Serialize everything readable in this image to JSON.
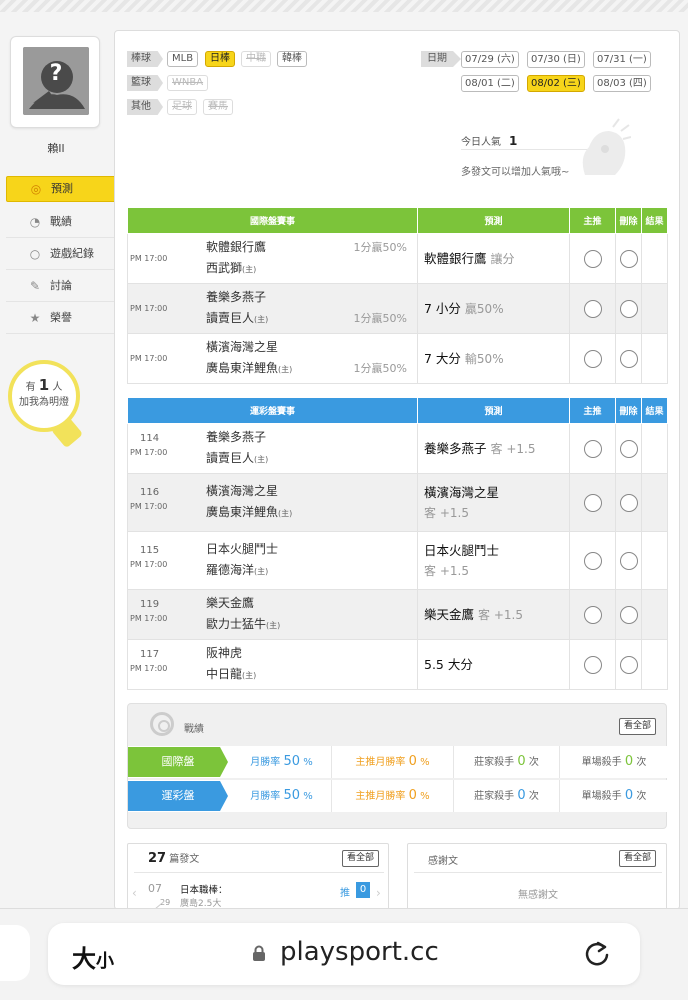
{
  "sidebar": {
    "avatar_glyph": "?",
    "username": "賴ll",
    "menu": [
      {
        "label": "預測",
        "icon": "target-icon"
      },
      {
        "label": "戰績",
        "icon": "chart-icon"
      },
      {
        "label": "遊戲紀錄",
        "icon": "record-icon"
      },
      {
        "label": "討論",
        "icon": "chat-icon"
      },
      {
        "label": "榮譽",
        "icon": "medal-icon"
      }
    ],
    "bulb_prefix": "有",
    "bulb_count": "1",
    "bulb_suffix": "人",
    "bulb_text": "加我為明燈"
  },
  "filters": {
    "baseball_label": "棒球",
    "baseball": [
      "MLB",
      "日棒",
      "中職",
      "韓棒"
    ],
    "basketball_label": "籃球",
    "basketball": [
      "WNBA"
    ],
    "other_label": "其他",
    "other": [
      "足球",
      "賽馬"
    ]
  },
  "dates": {
    "label": "日期",
    "items": [
      "07/29 (六)",
      "07/30 (日)",
      "07/31 (一)",
      "08/01 (二)",
      "08/02 (三)",
      "08/03 (四)"
    ],
    "selected": "08/02 (三)"
  },
  "popularity": {
    "label": "今日人氣",
    "value": "1",
    "desc": "多發文可以增加人氣哦~"
  },
  "intl_table": {
    "headers": [
      "國際盤賽事",
      "預測",
      "主推",
      "刪除",
      "結果"
    ],
    "rows": [
      {
        "time": "PM 17:00",
        "team1": "軟體銀行鷹",
        "team2": "西武獅",
        "home_mark": "(主)",
        "handicap": "1分贏50%",
        "pred_main": "軟體銀行鷹",
        "pred_sub": "讓分"
      },
      {
        "time": "PM 17:00",
        "team1": "養樂多燕子",
        "team2": "讀賣巨人",
        "home_mark": "(主)",
        "handicap": "1分贏50%",
        "pred_main": "7 小分",
        "pred_sub": "贏50%"
      },
      {
        "time": "PM 17:00",
        "team1": "橫濱海灣之星",
        "team2": "廣島東洋鯉魚",
        "home_mark": "(主)",
        "handicap": "1分贏50%",
        "pred_main": "7 大分",
        "pred_sub": "輸50%"
      }
    ]
  },
  "lottery_table": {
    "headers": [
      "運彩盤賽事",
      "預測",
      "主推",
      "刪除",
      "結果"
    ],
    "rows": [
      {
        "no": "114",
        "time": "PM 17:00",
        "team1": "養樂多燕子",
        "team2": "讀賣巨人",
        "home_mark": "(主)",
        "pred_main": "養樂多燕子",
        "pred_sub": "客 +1.5"
      },
      {
        "no": "116",
        "time": "PM 17:00",
        "team1": "橫濱海灣之星",
        "team2": "廣島東洋鯉魚",
        "home_mark": "(主)",
        "pred_main": "橫濱海灣之星",
        "pred_sub": "客 +1.5"
      },
      {
        "no": "115",
        "time": "PM 17:00",
        "team1": "日本火腿鬥士",
        "team2": "羅德海洋",
        "home_mark": "(主)",
        "pred_main": "日本火腿鬥士",
        "pred_sub": "客 +1.5"
      },
      {
        "no": "119",
        "time": "PM 17:00",
        "team1": "樂天金鷹",
        "team2": "歐力士猛牛",
        "home_mark": "(主)",
        "pred_main": "樂天金鷹",
        "pred_sub": "客 +1.5"
      },
      {
        "no": "117",
        "time": "PM 17:00",
        "team1": "阪神虎",
        "team2": "中日龍",
        "home_mark": "(主)",
        "pred_main": "5.5 大分",
        "pred_sub": ""
      }
    ]
  },
  "record": {
    "title": "戰績",
    "view_all": "看全部",
    "rows": [
      {
        "label": "國際盤",
        "color": "#7cc43a",
        "month_label": "月勝率",
        "month_value": "50",
        "pct": "%",
        "main_label": "主推月勝率",
        "main_value": "0",
        "killer_label": "莊家殺手",
        "killer_value": "0",
        "unit": "次",
        "single_label": "單場殺手",
        "single_value": "0"
      },
      {
        "label": "運彩盤",
        "color": "#3a9ae0",
        "month_label": "月勝率",
        "month_value": "50",
        "pct": "%",
        "main_label": "主推月勝率",
        "main_value": "0",
        "killer_label": "莊家殺手",
        "killer_value": "0",
        "unit": "次",
        "single_label": "單場殺手",
        "single_value": "0"
      }
    ]
  },
  "posts": {
    "count": "27",
    "label": "篇發文",
    "view_all": "看全部",
    "item_month": "07",
    "item_day": "29",
    "item_title": "日本職棒：",
    "item_sub": "廣島2.5大",
    "push_label": "推",
    "push_count": "0"
  },
  "thanks": {
    "title": "感謝文",
    "view_all": "看全部",
    "empty": "無感謝文"
  },
  "browser": {
    "text_size_big": "大",
    "text_size_small": "小",
    "url": "playsport.cc"
  }
}
